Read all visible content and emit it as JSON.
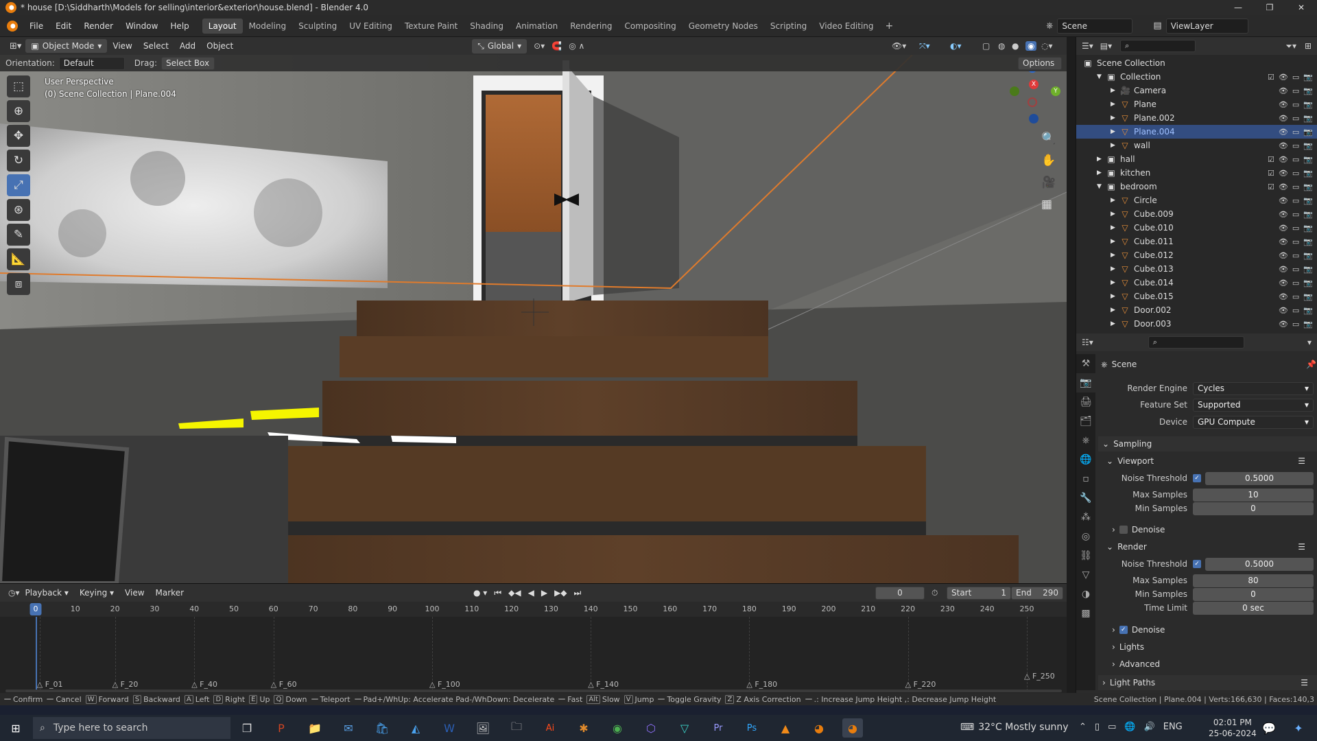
{
  "title": "* house [D:\\Siddharth\\Models for selling\\interior&exterior\\house.blend] - Blender 4.0",
  "menu": [
    "File",
    "Edit",
    "Render",
    "Window",
    "Help"
  ],
  "workspaces": [
    "Layout",
    "Modeling",
    "Sculpting",
    "UV Editing",
    "Texture Paint",
    "Shading",
    "Animation",
    "Rendering",
    "Compositing",
    "Geometry Nodes",
    "Scripting",
    "Video Editing"
  ],
  "active_workspace": "Layout",
  "scene": "Scene",
  "view_layer": "ViewLayer",
  "viewport": {
    "mode": "Object Mode",
    "view": "View",
    "select": "Select",
    "add": "Add",
    "object": "Object",
    "transform": "Global",
    "orientation_label": "Orientation:",
    "orientation": "Default",
    "drag_label": "Drag:",
    "drag": "Select Box",
    "options": "Options",
    "info_line1": "User Perspective",
    "info_line2": "(0) Scene Collection | Plane.004",
    "gizmo": {
      "x": "X",
      "y": "Y",
      "z": "Z"
    }
  },
  "outliner": {
    "root": "Scene Collection",
    "rows": [
      {
        "label": "Collection",
        "type": "collection",
        "indent": 1,
        "expanded": true
      },
      {
        "label": "Camera",
        "type": "camera",
        "indent": 2
      },
      {
        "label": "Plane",
        "type": "mesh",
        "indent": 2
      },
      {
        "label": "Plane.002",
        "type": "mesh",
        "indent": 2
      },
      {
        "label": "Plane.004",
        "type": "mesh",
        "indent": 2,
        "selected": true
      },
      {
        "label": "wall",
        "type": "mesh",
        "indent": 2
      },
      {
        "label": "hall",
        "type": "collection",
        "indent": 1
      },
      {
        "label": "kitchen",
        "type": "collection",
        "indent": 1
      },
      {
        "label": "bedroom",
        "type": "collection",
        "indent": 1,
        "expanded": true
      },
      {
        "label": "Circle",
        "type": "mesh",
        "indent": 2
      },
      {
        "label": "Cube.009",
        "type": "mesh",
        "indent": 2
      },
      {
        "label": "Cube.010",
        "type": "mesh",
        "indent": 2
      },
      {
        "label": "Cube.011",
        "type": "mesh",
        "indent": 2
      },
      {
        "label": "Cube.012",
        "type": "mesh",
        "indent": 2
      },
      {
        "label": "Cube.013",
        "type": "mesh",
        "indent": 2
      },
      {
        "label": "Cube.014",
        "type": "mesh",
        "indent": 2
      },
      {
        "label": "Cube.015",
        "type": "mesh",
        "indent": 2
      },
      {
        "label": "Door.002",
        "type": "mesh",
        "indent": 2
      },
      {
        "label": "Door.003",
        "type": "mesh",
        "indent": 2
      }
    ]
  },
  "properties": {
    "context": "Scene",
    "render_engine_label": "Render Engine",
    "render_engine": "Cycles",
    "feature_set_label": "Feature Set",
    "feature_set": "Supported",
    "device_label": "Device",
    "device": "GPU Compute",
    "sampling": "Sampling",
    "viewport_section": "Viewport",
    "noise_threshold_label": "Noise Threshold",
    "vp_noise": "0.5000",
    "max_samples_label": "Max Samples",
    "vp_max": "10",
    "min_samples_label": "Min Samples",
    "vp_min": "0",
    "denoise": "Denoise",
    "render_section": "Render",
    "r_noise": "0.5000",
    "r_max": "80",
    "r_min": "0",
    "time_limit_label": "Time Limit",
    "r_time": "0 sec",
    "lights": "Lights",
    "advanced": "Advanced",
    "light_paths": "Light Paths"
  },
  "timeline": {
    "playback": "Playback",
    "keying": "Keying",
    "view": "View",
    "marker": "Marker",
    "current": "0",
    "start_label": "Start",
    "start": "1",
    "end_label": "End",
    "end": "290",
    "ticks": [
      "0",
      "10",
      "20",
      "30",
      "40",
      "50",
      "60",
      "70",
      "80",
      "90",
      "100",
      "110",
      "120",
      "130",
      "140",
      "150",
      "160",
      "170",
      "180",
      "190",
      "200",
      "210",
      "220",
      "230",
      "240",
      "250"
    ],
    "markers": [
      {
        "label": "F_01",
        "frame": 1
      },
      {
        "label": "F_20",
        "frame": 20
      },
      {
        "label": "F_40",
        "frame": 40
      },
      {
        "label": "F_60",
        "frame": 60
      },
      {
        "label": "F_100",
        "frame": 100
      },
      {
        "label": "F_140",
        "frame": 140
      },
      {
        "label": "F_180",
        "frame": 180
      },
      {
        "label": "F_220",
        "frame": 220
      },
      {
        "label": "F_250",
        "frame": 250
      }
    ]
  },
  "status": {
    "items": [
      {
        "key": "",
        "label": "Confirm"
      },
      {
        "key": "",
        "label": "Cancel"
      },
      {
        "key": "W",
        "label": "Forward"
      },
      {
        "key": "S",
        "label": "Backward"
      },
      {
        "key": "A",
        "label": "Left"
      },
      {
        "key": "D",
        "label": "Right"
      },
      {
        "key": "E",
        "label": "Up"
      },
      {
        "key": "Q",
        "label": "Down"
      },
      {
        "key": "",
        "label": "Teleport"
      },
      {
        "key": "",
        "label": "Pad+/WhUp: Accelerate  Pad-/WhDown: Decelerate"
      },
      {
        "key": "",
        "label": "Fast"
      },
      {
        "key": "Alt",
        "label": "Slow"
      },
      {
        "key": "V",
        "label": "Jump"
      },
      {
        "key": "",
        "label": "Toggle Gravity"
      },
      {
        "key": "Z",
        "label": "Z Axis Correction"
      },
      {
        "key": "",
        "label": ".: Increase Jump Height  ,: Decrease Jump Height"
      }
    ],
    "right": "Scene Collection | Plane.004 | Verts:166,630 | Faces:140,3"
  },
  "taskbar": {
    "search": "Type here to search",
    "weather": "32°C  Mostly sunny",
    "lang": "ENG",
    "time": "02:01 PM",
    "date": "25-06-2024"
  },
  "colors": {
    "accent": "#4772b3",
    "selection": "#334d80",
    "orange": "#e87d0d"
  }
}
